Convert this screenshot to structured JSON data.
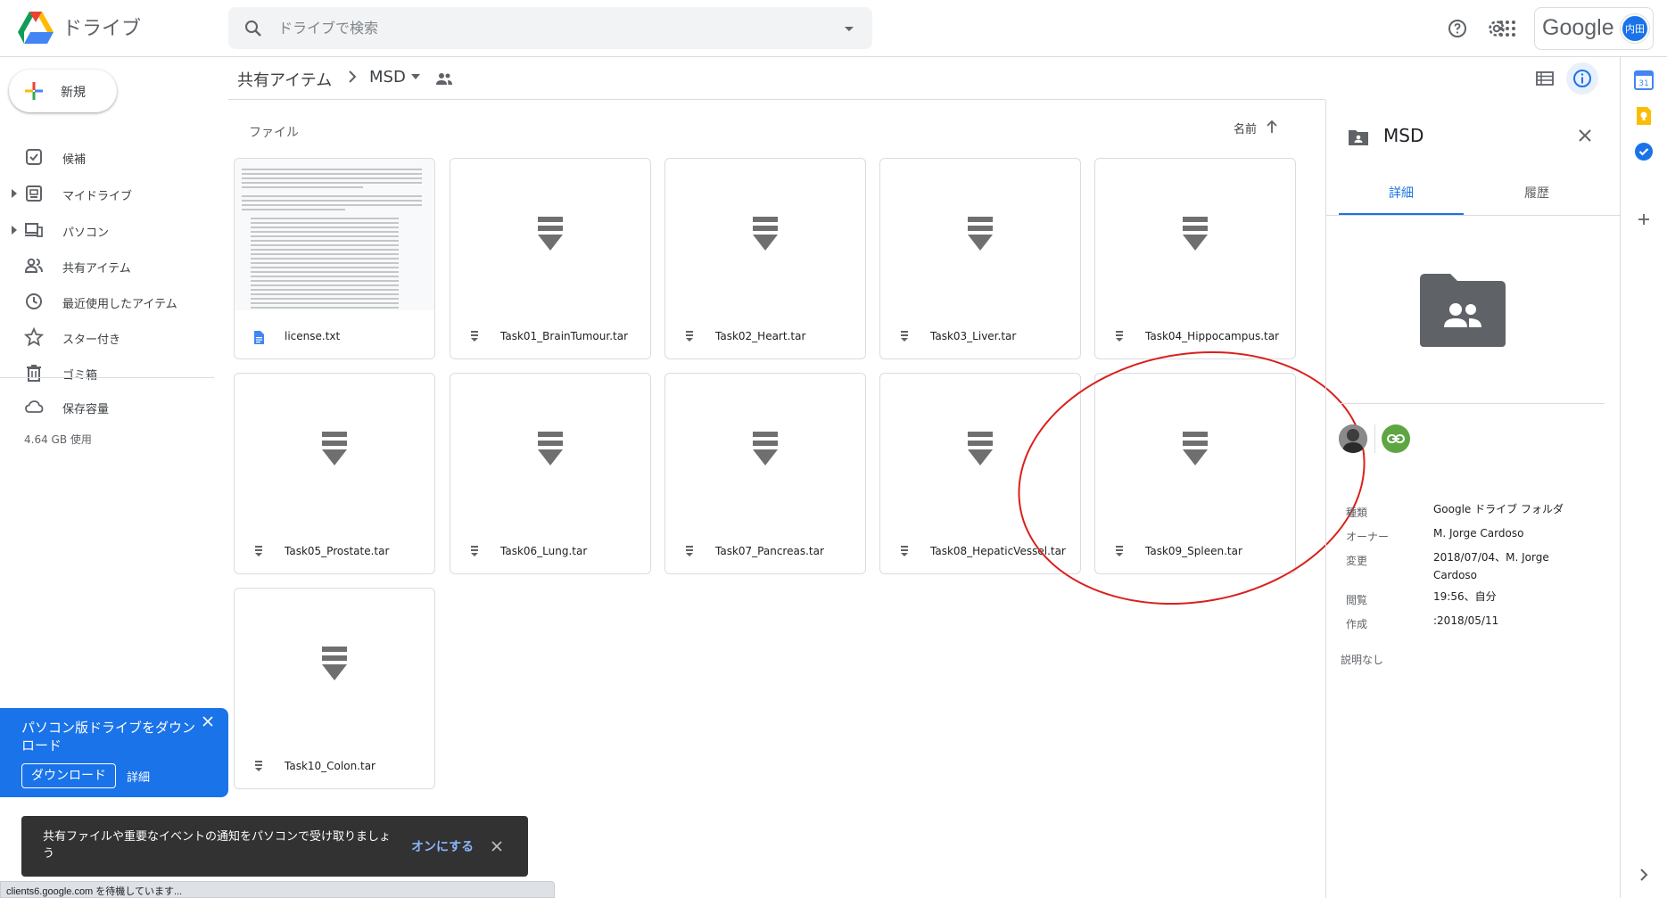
{
  "header": {
    "app_title": "ドライブ",
    "search_placeholder": "ドライブで検索",
    "google_wordmark": "Google",
    "avatar_initials": "内田"
  },
  "sidebar": {
    "new_label": "新規",
    "items": [
      {
        "label": "候補",
        "icon": "check-square-icon"
      },
      {
        "label": "マイドライブ",
        "icon": "my-drive-icon"
      },
      {
        "label": "パソコン",
        "icon": "computer-icon"
      },
      {
        "label": "共有アイテム",
        "icon": "people-icon"
      },
      {
        "label": "最近使用したアイテム",
        "icon": "clock-icon"
      },
      {
        "label": "スター付き",
        "icon": "star-icon"
      },
      {
        "label": "ゴミ箱",
        "icon": "trash-icon"
      }
    ],
    "storage_label": "保存容量",
    "storage_usage": "4.64 GB 使用"
  },
  "breadcrumb": {
    "root": "共有アイテム",
    "current": "MSD"
  },
  "files_section": {
    "heading": "ファイル",
    "sort_label": "名前"
  },
  "files": [
    {
      "name": "license.txt",
      "type": "document"
    },
    {
      "name": "Task01_BrainTumour.tar",
      "type": "archive"
    },
    {
      "name": "Task02_Heart.tar",
      "type": "archive"
    },
    {
      "name": "Task03_Liver.tar",
      "type": "archive"
    },
    {
      "name": "Task04_Hippocampus.tar",
      "type": "archive"
    },
    {
      "name": "Task05_Prostate.tar",
      "type": "archive"
    },
    {
      "name": "Task06_Lung.tar",
      "type": "archive"
    },
    {
      "name": "Task07_Pancreas.tar",
      "type": "archive"
    },
    {
      "name": "Task08_HepaticVessel.tar",
      "type": "archive"
    },
    {
      "name": "Task09_Spleen.tar",
      "type": "archive"
    },
    {
      "name": "Task10_Colon.tar",
      "type": "archive"
    }
  ],
  "details_panel": {
    "title": "MSD",
    "tab_details": "詳細",
    "tab_history": "履歴",
    "properties": [
      {
        "label": "種類",
        "value": "Google ドライブ フォルダ"
      },
      {
        "label": "オーナー",
        "value": "M. Jorge Cardoso"
      },
      {
        "label": "変更",
        "value": "2018/07/04、M. Jorge Cardoso"
      },
      {
        "label": "閲覧",
        "value": "19:56、自分"
      },
      {
        "label": "作成",
        "value": ":2018/05/11"
      }
    ],
    "no_description": "説明なし"
  },
  "download_promo": {
    "text": "パソコン版ドライブをダウンロード",
    "download_button": "ダウンロード",
    "details_link": "詳細"
  },
  "snackbar": {
    "text": "共有ファイルや重要なイベントの通知をパソコンで受け取りましょう",
    "action": "オンにする"
  },
  "status_bar": {
    "text": "clients6.google.com を待機しています..."
  },
  "colors": {
    "accent": "#1a73e8",
    "annotation": "#d9201c",
    "link_share": "#5ea642"
  }
}
